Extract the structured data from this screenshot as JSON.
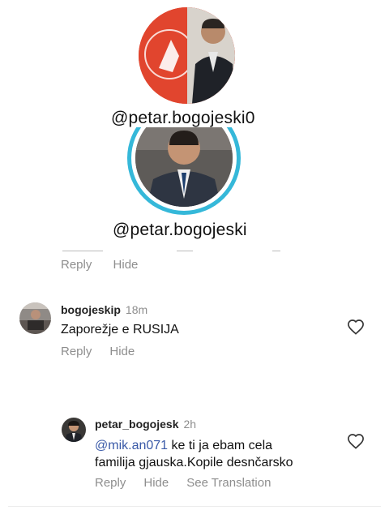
{
  "profiles": [
    {
      "handle": "@petar.bogojeski0",
      "avatar_icon": "profile-photo-orange-logo"
    },
    {
      "handle": "@petar.bogojeski",
      "avatar_icon": "profile-photo-story-ring",
      "ring_color": "#35b8d9"
    }
  ],
  "cutoff_row": {
    "reply": "Reply",
    "hide": "Hide"
  },
  "comments": [
    {
      "username": "bogojeskip",
      "time": "18m",
      "text": "Zaporežje e RUSIJA",
      "actions": {
        "reply": "Reply",
        "hide": "Hide"
      }
    },
    {
      "username": "petar_bogojesk",
      "time": "2h",
      "mention": "@mik.an071",
      "text_line1": " ke ti ja ebam cela",
      "text_line2": "familija gjauska.Kopile desnčarsko",
      "actions": {
        "reply": "Reply",
        "hide": "Hide",
        "translate": "See Translation"
      }
    }
  ],
  "colors": {
    "muted": "#8e8e8e",
    "mention": "#3a5aa8",
    "accent_orange": "#e1452e"
  }
}
